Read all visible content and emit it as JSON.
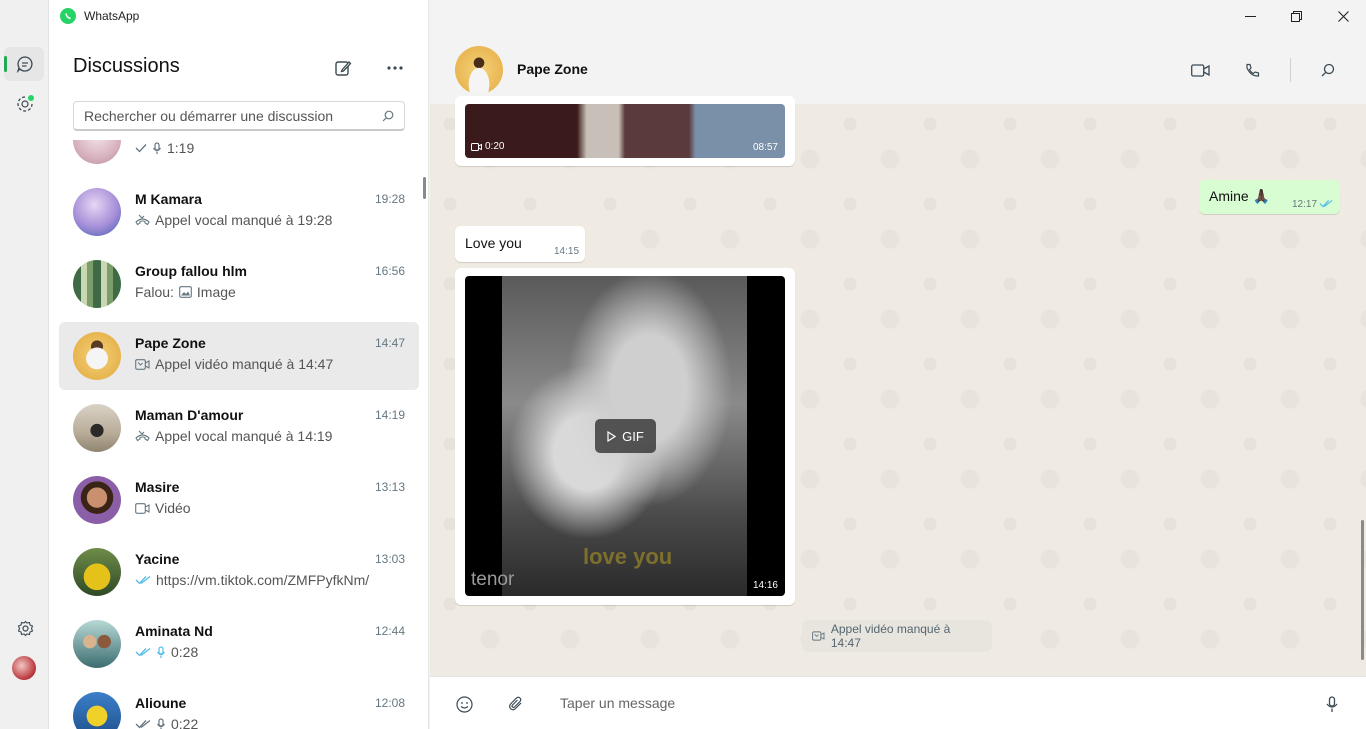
{
  "app": {
    "title": "WhatsApp"
  },
  "sidebar": {
    "heading": "Discussions",
    "search_placeholder": "Rechercher ou démarrer une discussion",
    "chats": [
      {
        "name": "",
        "time": "",
        "preview": "1:19",
        "preview_icon": "mic-icon",
        "status": "single-check"
      },
      {
        "name": "M Kamara",
        "time": "19:28",
        "preview": "Appel vocal manqué à 19:28",
        "preview_icon": "missed-voice-call-icon"
      },
      {
        "name": "Group fallou hlm",
        "time": "16:56",
        "preview": "Falou: ",
        "preview_extra": "Image",
        "preview_icon": "image-icon"
      },
      {
        "name": "Pape Zone",
        "time": "14:47",
        "preview": "Appel vidéo manqué à 14:47",
        "preview_icon": "missed-video-call-icon",
        "selected": true
      },
      {
        "name": "Maman D'amour",
        "time": "14:19",
        "preview": "Appel vocal manqué à 14:19",
        "preview_icon": "missed-voice-call-icon"
      },
      {
        "name": "Masire",
        "time": "13:13",
        "preview": "Vidéo",
        "preview_icon": "video-icon"
      },
      {
        "name": "Yacine",
        "time": "13:03",
        "preview": "https://vm.tiktok.com/ZMFPyfkNm/",
        "preview_icon": "double-check-icon"
      },
      {
        "name": "Aminata Nd",
        "time": "12:44",
        "preview": "0:28",
        "preview_icon": "mic-icon",
        "status": "double-check"
      },
      {
        "name": "Alioune",
        "time": "12:08",
        "preview": "0:22",
        "preview_icon": "mic-icon",
        "status": "double-check"
      }
    ]
  },
  "chat": {
    "contact_name": "Pape Zone",
    "messages": {
      "video_duration": "0:20",
      "video_time": "08:57",
      "out_text": "Amine 🙏🏿",
      "out_time": "12:17",
      "in_text": "Love you",
      "in_time": "14:15",
      "gif_label": "GIF",
      "gif_caption": "love you",
      "gif_watermark": "tenor",
      "gif_time": "14:16",
      "system_text": "Appel vidéo manqué à 14:47"
    },
    "composer_placeholder": "Taper un message"
  },
  "colors": {
    "accent": "#25d366",
    "outgoing_bubble": "#d9fdd3",
    "read_tick": "#53bdeb",
    "selected_row": "#eaeaea"
  }
}
